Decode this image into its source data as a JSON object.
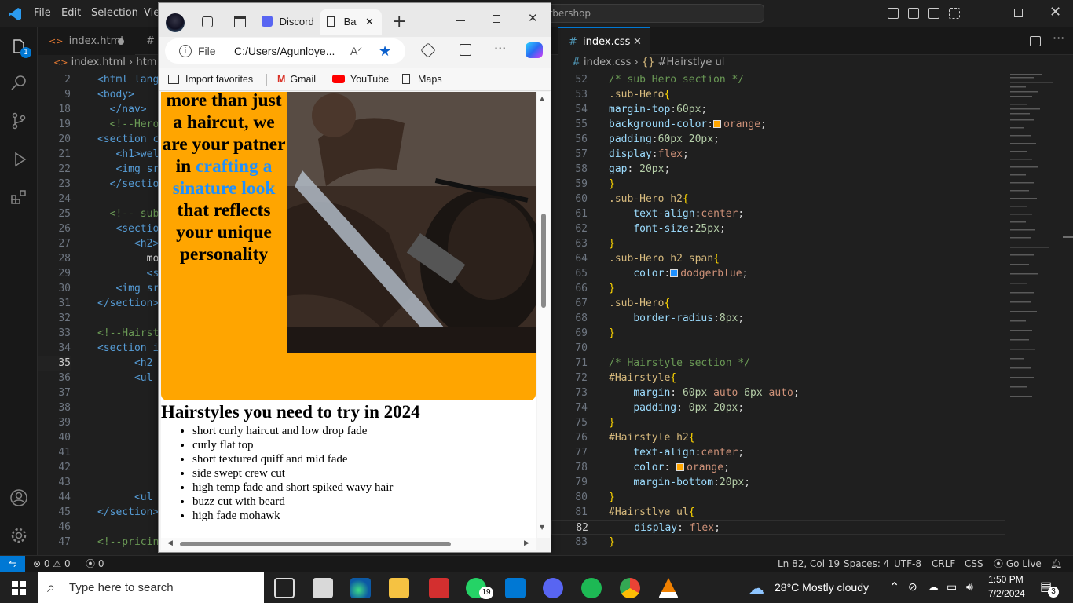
{
  "vscode": {
    "menu": [
      "File",
      "Edit",
      "Selection",
      "Vie"
    ],
    "command_center": "arbershop",
    "activity_badge": "1",
    "left_tabs": [
      {
        "label": "index.html"
      }
    ],
    "left_breadcrumb": [
      "index.html",
      "htm"
    ],
    "left_lines": [
      {
        "n": "2",
        "code": "<html lang"
      },
      {
        "n": "9",
        "code": "<body>"
      },
      {
        "n": "18",
        "code": "  </nav>"
      },
      {
        "n": "19",
        "code": "  <!--Hero"
      },
      {
        "n": "20",
        "code": "<section c"
      },
      {
        "n": "21",
        "code": "   <h1>wel"
      },
      {
        "n": "22",
        "code": "   <img sr"
      },
      {
        "n": "23",
        "code": "  </section"
      },
      {
        "n": "24",
        "code": ""
      },
      {
        "n": "25",
        "code": "  <!-- sub-"
      },
      {
        "n": "26",
        "code": "   <section"
      },
      {
        "n": "27",
        "code": "      <h2>"
      },
      {
        "n": "28",
        "code": "        mor"
      },
      {
        "n": "29",
        "code": "        <sp"
      },
      {
        "n": "30",
        "code": "   <img sr"
      },
      {
        "n": "31",
        "code": "</section>"
      },
      {
        "n": "32",
        "code": ""
      },
      {
        "n": "33",
        "code": "<!--Hairst"
      },
      {
        "n": "34",
        "code": "<section i"
      },
      {
        "n": "35",
        "code": "      <h2"
      },
      {
        "n": "36",
        "code": "      <ul"
      },
      {
        "n": "37",
        "code": ""
      },
      {
        "n": "38",
        "code": ""
      },
      {
        "n": "39",
        "code": ""
      },
      {
        "n": "40",
        "code": ""
      },
      {
        "n": "41",
        "code": ""
      },
      {
        "n": "42",
        "code": ""
      },
      {
        "n": "43",
        "code": ""
      },
      {
        "n": "44",
        "code": "      <ul"
      },
      {
        "n": "45",
        "code": "</section>"
      },
      {
        "n": "46",
        "code": ""
      },
      {
        "n": "47",
        "code": "<!--pricin"
      }
    ],
    "right_tab": "index.css",
    "right_breadcrumb": [
      "index.css",
      "#Hairstlye ul"
    ],
    "right_lines": [
      {
        "n": "52",
        "t": [
          [
            "cmt",
            "/* sub Hero section */"
          ]
        ]
      },
      {
        "n": "53",
        "t": [
          [
            "sel",
            ".sub-Hero"
          ],
          [
            "br",
            "{"
          ]
        ]
      },
      {
        "n": "54",
        "t": [
          [
            "prop",
            "margin-top"
          ],
          [
            "p",
            ":"
          ],
          [
            "num",
            "60px"
          ],
          [
            "p",
            ";"
          ]
        ]
      },
      {
        "n": "55",
        "t": [
          [
            "prop",
            "background-color"
          ],
          [
            "p",
            ":"
          ],
          [
            "sw",
            "#ffa500"
          ],
          [
            "val",
            "orange"
          ],
          [
            "p",
            ";"
          ]
        ]
      },
      {
        "n": "56",
        "t": [
          [
            "prop",
            "padding"
          ],
          [
            "p",
            ":"
          ],
          [
            "num",
            "60px 20px"
          ],
          [
            "p",
            ";"
          ]
        ]
      },
      {
        "n": "57",
        "t": [
          [
            "prop",
            "display"
          ],
          [
            "p",
            ":"
          ],
          [
            "val",
            "flex"
          ],
          [
            "p",
            ";"
          ]
        ]
      },
      {
        "n": "58",
        "t": [
          [
            "prop",
            "gap"
          ],
          [
            "p",
            ": "
          ],
          [
            "num",
            "20px"
          ],
          [
            "p",
            ";"
          ]
        ]
      },
      {
        "n": "59",
        "t": [
          [
            "br",
            "}"
          ]
        ]
      },
      {
        "n": "60",
        "t": [
          [
            "sel",
            ".sub-Hero h2"
          ],
          [
            "br",
            "{"
          ]
        ]
      },
      {
        "n": "61",
        "t": [
          [
            "p",
            "    "
          ],
          [
            "prop",
            "text-align"
          ],
          [
            "p",
            ":"
          ],
          [
            "val",
            "center"
          ],
          [
            "p",
            ";"
          ]
        ]
      },
      {
        "n": "62",
        "t": [
          [
            "p",
            "    "
          ],
          [
            "prop",
            "font-size"
          ],
          [
            "p",
            ":"
          ],
          [
            "num",
            "25px"
          ],
          [
            "p",
            ";"
          ]
        ]
      },
      {
        "n": "63",
        "t": [
          [
            "br",
            "}"
          ]
        ]
      },
      {
        "n": "64",
        "t": [
          [
            "sel",
            ".sub-Hero h2 span"
          ],
          [
            "br",
            "{"
          ]
        ]
      },
      {
        "n": "65",
        "t": [
          [
            "p",
            "    "
          ],
          [
            "prop",
            "color"
          ],
          [
            "p",
            ":"
          ],
          [
            "sw",
            "#1e90ff"
          ],
          [
            "val",
            "dodgerblue"
          ],
          [
            "p",
            ";"
          ]
        ]
      },
      {
        "n": "66",
        "t": [
          [
            "br",
            "}"
          ]
        ]
      },
      {
        "n": "67",
        "t": [
          [
            "sel",
            ".sub-Hero"
          ],
          [
            "br",
            "{"
          ]
        ]
      },
      {
        "n": "68",
        "t": [
          [
            "p",
            "    "
          ],
          [
            "prop",
            "border-radius"
          ],
          [
            "p",
            ":"
          ],
          [
            "num",
            "8px"
          ],
          [
            "p",
            ";"
          ]
        ]
      },
      {
        "n": "69",
        "t": [
          [
            "br",
            "}"
          ]
        ]
      },
      {
        "n": "70",
        "t": []
      },
      {
        "n": "71",
        "t": [
          [
            "cmt",
            "/* Hairstyle section */"
          ]
        ]
      },
      {
        "n": "72",
        "t": [
          [
            "sel",
            "#Hairstyle"
          ],
          [
            "br",
            "{"
          ]
        ]
      },
      {
        "n": "73",
        "t": [
          [
            "p",
            "    "
          ],
          [
            "prop",
            "margin"
          ],
          [
            "p",
            ": "
          ],
          [
            "num",
            "60px"
          ],
          [
            "p",
            " "
          ],
          [
            "val",
            "auto"
          ],
          [
            "p",
            " "
          ],
          [
            "num",
            "6px"
          ],
          [
            "p",
            " "
          ],
          [
            "val",
            "auto"
          ],
          [
            "p",
            ";"
          ]
        ]
      },
      {
        "n": "74",
        "t": [
          [
            "p",
            "    "
          ],
          [
            "prop",
            "padding"
          ],
          [
            "p",
            ": "
          ],
          [
            "num",
            "0px 20px"
          ],
          [
            "p",
            ";"
          ]
        ]
      },
      {
        "n": "75",
        "t": [
          [
            "br",
            "}"
          ]
        ]
      },
      {
        "n": "76",
        "t": [
          [
            "sel",
            "#Hairstyle h2"
          ],
          [
            "br",
            "{"
          ]
        ]
      },
      {
        "n": "77",
        "t": [
          [
            "p",
            "    "
          ],
          [
            "prop",
            "text-align"
          ],
          [
            "p",
            ":"
          ],
          [
            "val",
            "center"
          ],
          [
            "p",
            ";"
          ]
        ]
      },
      {
        "n": "78",
        "t": [
          [
            "p",
            "    "
          ],
          [
            "prop",
            "color"
          ],
          [
            "p",
            ": "
          ],
          [
            "sw",
            "#ffa500"
          ],
          [
            "val",
            "orange"
          ],
          [
            "p",
            ";"
          ]
        ]
      },
      {
        "n": "79",
        "t": [
          [
            "p",
            "    "
          ],
          [
            "prop",
            "margin-bottom"
          ],
          [
            "p",
            ":"
          ],
          [
            "num",
            "20px"
          ],
          [
            "p",
            ";"
          ]
        ]
      },
      {
        "n": "80",
        "t": [
          [
            "br",
            "}"
          ]
        ]
      },
      {
        "n": "81",
        "t": [
          [
            "sel",
            "#Hairstlye ul"
          ],
          [
            "br",
            "{"
          ]
        ]
      },
      {
        "n": "82",
        "t": [
          [
            "p",
            "    "
          ],
          [
            "prop",
            "display"
          ],
          [
            "p",
            ": "
          ],
          [
            "val",
            "flex"
          ],
          [
            "p",
            ";"
          ]
        ]
      },
      {
        "n": "83",
        "t": [
          [
            "br",
            "}"
          ]
        ]
      }
    ],
    "status": {
      "errors": "0",
      "warnings": "0",
      "ports": "0",
      "position": "Ln 82, Col 19",
      "spaces": "Spaces: 4",
      "encoding": "UTF-8",
      "eol": "CRLF",
      "language": "CSS",
      "golive": "Go Live"
    }
  },
  "browser": {
    "tabs": [
      {
        "label": "Discord"
      },
      {
        "label": "Ba"
      }
    ],
    "address_prefix": "File",
    "address": "C:/Users/Agunloye...",
    "favorites": [
      "Import favorites",
      "Gmail",
      "YouTube",
      "Maps"
    ],
    "page": {
      "hero_text_before": "more than just a haircut, we are your patner in",
      "hero_text_span": "crafting a sinature look",
      "hero_text_after": "that reflects your unique personality",
      "hairstyle_title": "Hairstyles you need to try in 2024",
      "hairstyles": [
        "short curly haircut and low drop fade",
        "curly flat top",
        "short textured quiff and mid fade",
        "side swept crew cut",
        "high temp fade and short spiked wavy hair",
        "buzz cut with beard",
        "high fade mohawk"
      ]
    }
  },
  "taskbar": {
    "search_placeholder": "Type here to search",
    "whatsapp_badge": "19",
    "weather": "28°C  Mostly cloudy",
    "time": "1:50 PM",
    "date": "7/2/2024",
    "notifications": "3"
  }
}
